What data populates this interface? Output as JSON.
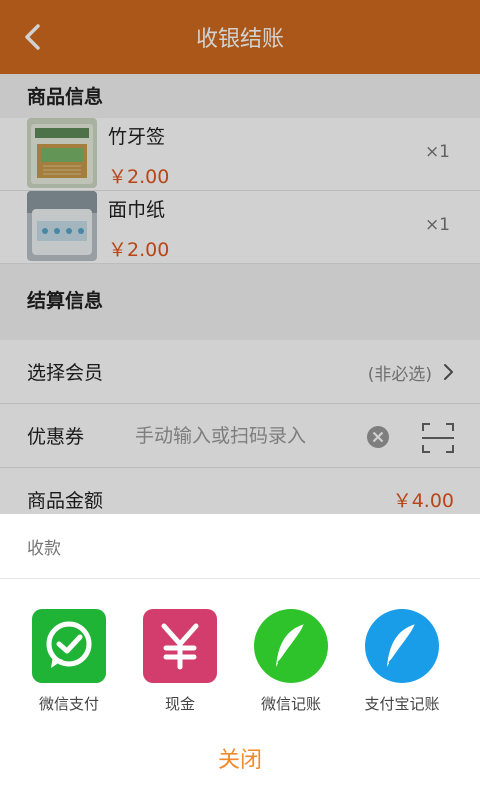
{
  "header": {
    "title": "收银结账"
  },
  "goods_section": {
    "title": "商品信息"
  },
  "goods": [
    {
      "name": "竹牙签",
      "price": "￥2.00",
      "qty": "×1",
      "thumb": "toothpick-image"
    },
    {
      "name": "面巾纸",
      "price": "￥2.00",
      "qty": "×1",
      "thumb": "tissue-image"
    }
  ],
  "settle_section": {
    "title": "结算信息"
  },
  "member": {
    "label": "选择会员",
    "hint": "(非必选)"
  },
  "coupon": {
    "label": "优惠券",
    "placeholder": "手动输入或扫码录入"
  },
  "amount": {
    "label": "商品金额",
    "value": "￥4.00"
  },
  "sheet": {
    "title": "收款",
    "methods": [
      {
        "label": "微信支付",
        "icon": "wechat-pay-icon",
        "color": "#20b437"
      },
      {
        "label": "现金",
        "icon": "yuan-icon",
        "color": "#d23d6d"
      },
      {
        "label": "微信记账",
        "icon": "feather-icon",
        "color": "#2fc32b"
      },
      {
        "label": "支付宝记账",
        "icon": "feather-icon",
        "color": "#199de8"
      }
    ],
    "close_label": "关闭"
  },
  "colors": {
    "brand": "#d06b1f",
    "price": "#e0561f",
    "close": "#f08a2a"
  }
}
